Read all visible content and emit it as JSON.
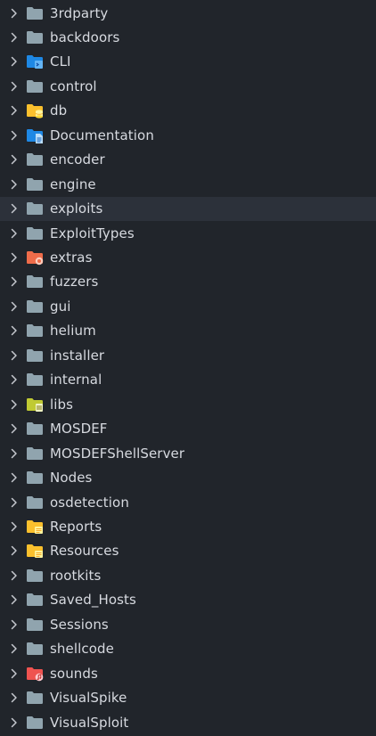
{
  "explorer": {
    "folders": [
      {
        "name": "3rdparty",
        "icon": "folder-icon",
        "color": "#90a4ae"
      },
      {
        "name": "backdoors",
        "icon": "folder-icon",
        "color": "#90a4ae"
      },
      {
        "name": "CLI",
        "icon": "folder-cli-icon",
        "color": "#1e88e5"
      },
      {
        "name": "control",
        "icon": "folder-icon",
        "color": "#90a4ae"
      },
      {
        "name": "db",
        "icon": "folder-database-icon",
        "color": "#fbc02d"
      },
      {
        "name": "Documentation",
        "icon": "folder-docs-icon",
        "color": "#1e88e5"
      },
      {
        "name": "encoder",
        "icon": "folder-icon",
        "color": "#90a4ae"
      },
      {
        "name": "engine",
        "icon": "folder-icon",
        "color": "#90a4ae"
      },
      {
        "name": "exploits",
        "icon": "folder-icon",
        "color": "#90a4ae",
        "selected": true
      },
      {
        "name": "ExploitTypes",
        "icon": "folder-icon",
        "color": "#90a4ae"
      },
      {
        "name": "extras",
        "icon": "folder-extras-icon",
        "color": "#ef6c4a"
      },
      {
        "name": "fuzzers",
        "icon": "folder-icon",
        "color": "#90a4ae"
      },
      {
        "name": "gui",
        "icon": "folder-icon",
        "color": "#90a4ae"
      },
      {
        "name": "helium",
        "icon": "folder-icon",
        "color": "#90a4ae"
      },
      {
        "name": "installer",
        "icon": "folder-icon",
        "color": "#90a4ae"
      },
      {
        "name": "internal",
        "icon": "folder-icon",
        "color": "#90a4ae"
      },
      {
        "name": "libs",
        "icon": "folder-lib-icon",
        "color": "#c0ca33"
      },
      {
        "name": "MOSDEF",
        "icon": "folder-icon",
        "color": "#90a4ae"
      },
      {
        "name": "MOSDEFShellServer",
        "icon": "folder-icon",
        "color": "#90a4ae"
      },
      {
        "name": "Nodes",
        "icon": "folder-icon",
        "color": "#90a4ae"
      },
      {
        "name": "osdetection",
        "icon": "folder-icon",
        "color": "#90a4ae"
      },
      {
        "name": "Reports",
        "icon": "folder-resource-icon",
        "color": "#fbc02d"
      },
      {
        "name": "Resources",
        "icon": "folder-resource-icon",
        "color": "#fbc02d"
      },
      {
        "name": "rootkits",
        "icon": "folder-icon",
        "color": "#90a4ae"
      },
      {
        "name": "Saved_Hosts",
        "icon": "folder-icon",
        "color": "#90a4ae"
      },
      {
        "name": "Sessions",
        "icon": "folder-icon",
        "color": "#90a4ae"
      },
      {
        "name": "shellcode",
        "icon": "folder-icon",
        "color": "#90a4ae"
      },
      {
        "name": "sounds",
        "icon": "folder-audio-icon",
        "color": "#ef5350"
      },
      {
        "name": "VisualSpike",
        "icon": "folder-icon",
        "color": "#90a4ae"
      },
      {
        "name": "VisualSploit",
        "icon": "folder-icon",
        "color": "#90a4ae"
      }
    ]
  }
}
